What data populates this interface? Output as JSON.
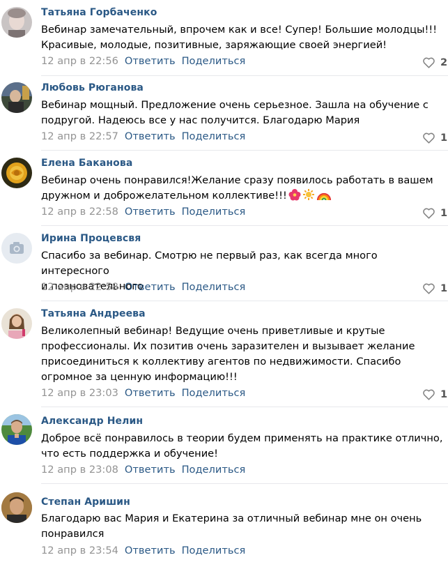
{
  "comments": [
    {
      "author": "Татьяна Горбаченко",
      "text": "Вебинар замечательный, впрочем как и все! Супер! Большие молодцы!!!\nКрасивые, молодые, позитивные, заряжающие своей энергией!",
      "date": "12 апр в 22:56",
      "reply": "Ответить",
      "share": "Поделиться",
      "likes": "2"
    },
    {
      "author": "Любовь Рюганова",
      "text": "Вебинар мощный. Предложение очень серьезное. Зашла на обучение с\nподругой. Надеюсь все у нас получится. Благодарю Мария",
      "date": "12 апр в 22:57",
      "reply": "Ответить",
      "share": "Поделиться",
      "likes": "1"
    },
    {
      "author": "Елена Баканова",
      "text": "Вебинар очень понравился!Желание сразу появилось работать в вашем\nдружном и доброжелательном коллективе!!!",
      "date": "12 апр в 22:58",
      "reply": "Ответить",
      "share": "Поделиться",
      "likes": "1"
    },
    {
      "author": "Ирина Процевсвя",
      "text": "Спасибо за вебинар. Смотрю не первый раз, как всегда много интересного\nи позноватeльного",
      "date": "12 апр в 22:58",
      "reply": "Ответить",
      "share": "Поделиться",
      "likes": "1"
    },
    {
      "author": "Татьяна Андреева",
      "text": "Великолепный вебинар! Ведущие очень приветливые и крутые\nпрофессионалы. Их позитив очень заразителен и вызывает желание\nприсоединиться к коллективу агентов по недвижимости. Спасибо\nогромное за ценную информацию!!!",
      "date": "12 апр в 23:03",
      "reply": "Ответить",
      "share": "Поделиться",
      "likes": "1"
    },
    {
      "author": "Александр Нелин",
      "text": "Доброе всё понравилось в теории будем применять на практике отлично,\nчто есть поддержка и обучение!",
      "date": "12 апр в 23:08",
      "reply": "Ответить",
      "share": "Поделиться",
      "likes": ""
    },
    {
      "author": "Степан Аришин",
      "text": "Благодарю вас Мария и Екатерина за отличный вебинар мне он очень\nпонравился",
      "date": "12 апр в 23:54",
      "reply": "Ответить",
      "share": "Поделиться",
      "likes": ""
    }
  ],
  "colors": {
    "link": "#2a5885",
    "date": "#939393",
    "text": "#000000",
    "divider": "#e7e8ec"
  },
  "icons": {
    "like": "heart-outline-icon",
    "emoji": [
      "hibiscus-emoji-icon",
      "sun-emoji-icon",
      "rainbow-emoji-icon"
    ]
  }
}
